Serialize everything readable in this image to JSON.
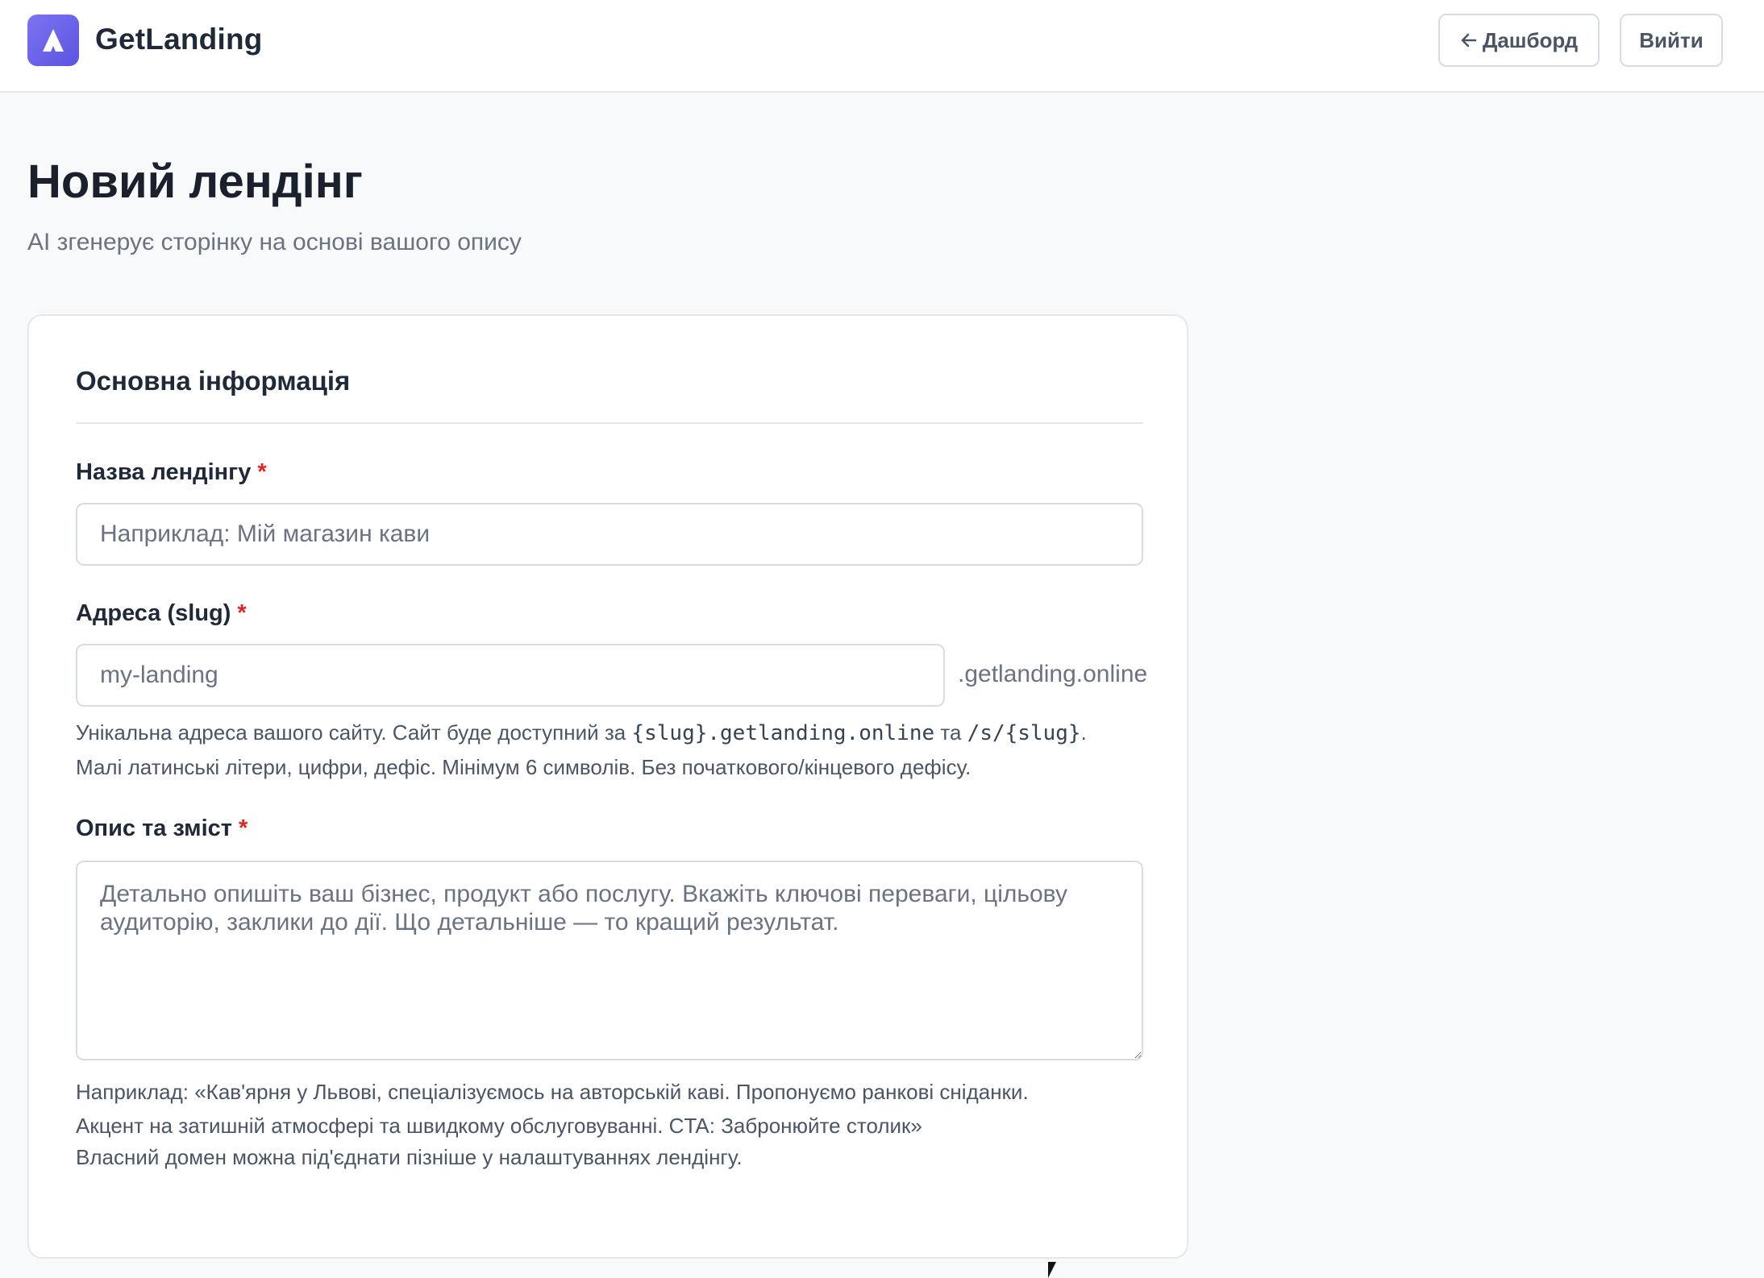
{
  "header": {
    "brand": "GetLanding",
    "logo_icon": "triangle-a-icon",
    "dashboard_label": "Дашборд",
    "dashboard_icon": "arrow-left-icon",
    "logout_label": "Вийти"
  },
  "page": {
    "title": "Новий лендінг",
    "subtitle": "AI згенерує сторінку на основі вашого опису"
  },
  "form": {
    "section_title": "Основна інформація",
    "required_mark": "*",
    "name": {
      "label": "Назва лендінгу",
      "placeholder": "Наприклад: Мій магазин кави"
    },
    "slug": {
      "label": "Адреса (slug)",
      "placeholder": "my-landing",
      "suffix": ".getlanding.online",
      "hint_prefix": "Унікальна адреса вашого сайту. Сайт буде доступний за ",
      "hint_code1": "{slug}.getlanding.online",
      "hint_mid": " та ",
      "hint_code2": "/s/{slug}",
      "hint_end": ".",
      "hint_line2": "Малі латинські літери, цифри, дефіс. Мінімум 6 символів. Без початкового/кінцевого дефісу."
    },
    "description": {
      "label": "Опис та зміст",
      "placeholder": "Детально опишіть ваш бізнес, продукт або послугу. Вкажіть ключові переваги, цільову аудиторію, заклики до дії. Що детальніше — то кращий результат.",
      "example_line1": "Наприклад: «Кав'ярня у Львові, спеціалізуємось на авторській каві. Пропонуємо ранкові сніданки.",
      "example_line2": "Акцент на затишній атмосфері та швидкому обслуговуванні. CTA: Забронюйте столик»"
    },
    "domain_note": "Власний домен можна під'єднати пізніше у налаштуваннях лендінгу."
  },
  "colors": {
    "accent": "#6c63ee",
    "required": "#dc2626"
  }
}
